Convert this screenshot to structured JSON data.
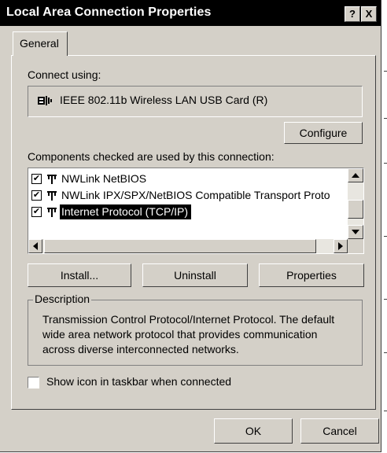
{
  "window": {
    "title": "Local Area Connection Properties",
    "help_button": "?",
    "close_button": "X"
  },
  "tabs": [
    {
      "label": "General"
    }
  ],
  "general": {
    "connect_using_label": "Connect using:",
    "device_name": "IEEE 802.11b Wireless LAN USB Card (R)",
    "configure_label": "Configure",
    "components_label": "Components checked are used by this connection:",
    "components": [
      {
        "label": "NWLink NetBIOS",
        "checked": true
      },
      {
        "label": "NWLink IPX/SPX/NetBIOS Compatible Transport Proto",
        "checked": true
      },
      {
        "label": "Internet Protocol (TCP/IP)",
        "checked": true,
        "selected": true
      }
    ],
    "install_label": "Install...",
    "uninstall_label": "Uninstall",
    "properties_label": "Properties",
    "description_label": "Description",
    "description_lines": [
      "Transmission Control Protocol/Internet Protocol. The default",
      "wide area network protocol that provides communication",
      "across diverse interconnected networks."
    ],
    "show_icon_label": "Show icon in taskbar when connected",
    "show_icon_checked": false
  },
  "footer": {
    "ok_label": "OK",
    "cancel_label": "Cancel"
  },
  "colors": {
    "face": "#d4d0c8",
    "titlebar": "#000000",
    "selection": "#000000"
  }
}
